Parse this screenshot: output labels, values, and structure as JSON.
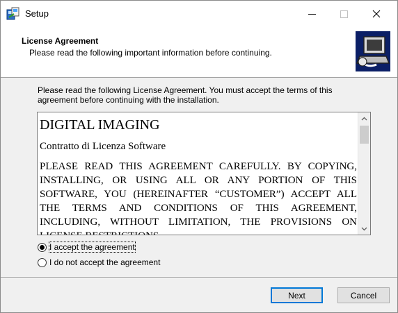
{
  "window": {
    "title": "Setup",
    "icons": {
      "app": "setup-app-icon",
      "minimize": "minimize-icon",
      "maximize": "maximize-icon",
      "close": "close-icon"
    }
  },
  "header": {
    "title": "License Agreement",
    "subtitle": "Please read the following important information before continuing.",
    "logo_icon": "installer-computer-icon"
  },
  "body": {
    "intro": "Please read the following License Agreement. You must accept the terms of this agreement before continuing with the installation.",
    "license": {
      "heading": "DIGITAL IMAGING",
      "subheading": "Contratto di Licenza Software",
      "text": "PLEASE READ THIS AGREEMENT CAREFULLY. BY COPYING, INSTALLING, OR USING ALL OR ANY PORTION OF THIS SOFTWARE, YOU (HEREINAFTER “CUSTOMER”) ACCEPT ALL THE TERMS AND CONDITIONS OF THIS AGREEMENT, INCLUDING, WITHOUT LIMITATION, THE PROVISIONS ON LICENSE RESTRICTIONS."
    },
    "radio": {
      "accept_label": "I accept the agreement",
      "decline_label": "I do not accept the agreement",
      "selected": "accept"
    }
  },
  "footer": {
    "next_label": "Next",
    "cancel_label": "Cancel"
  },
  "colors": {
    "accent": "#0078d7",
    "button_face": "#e1e1e1",
    "dialog_bg": "#f0f0f0"
  }
}
